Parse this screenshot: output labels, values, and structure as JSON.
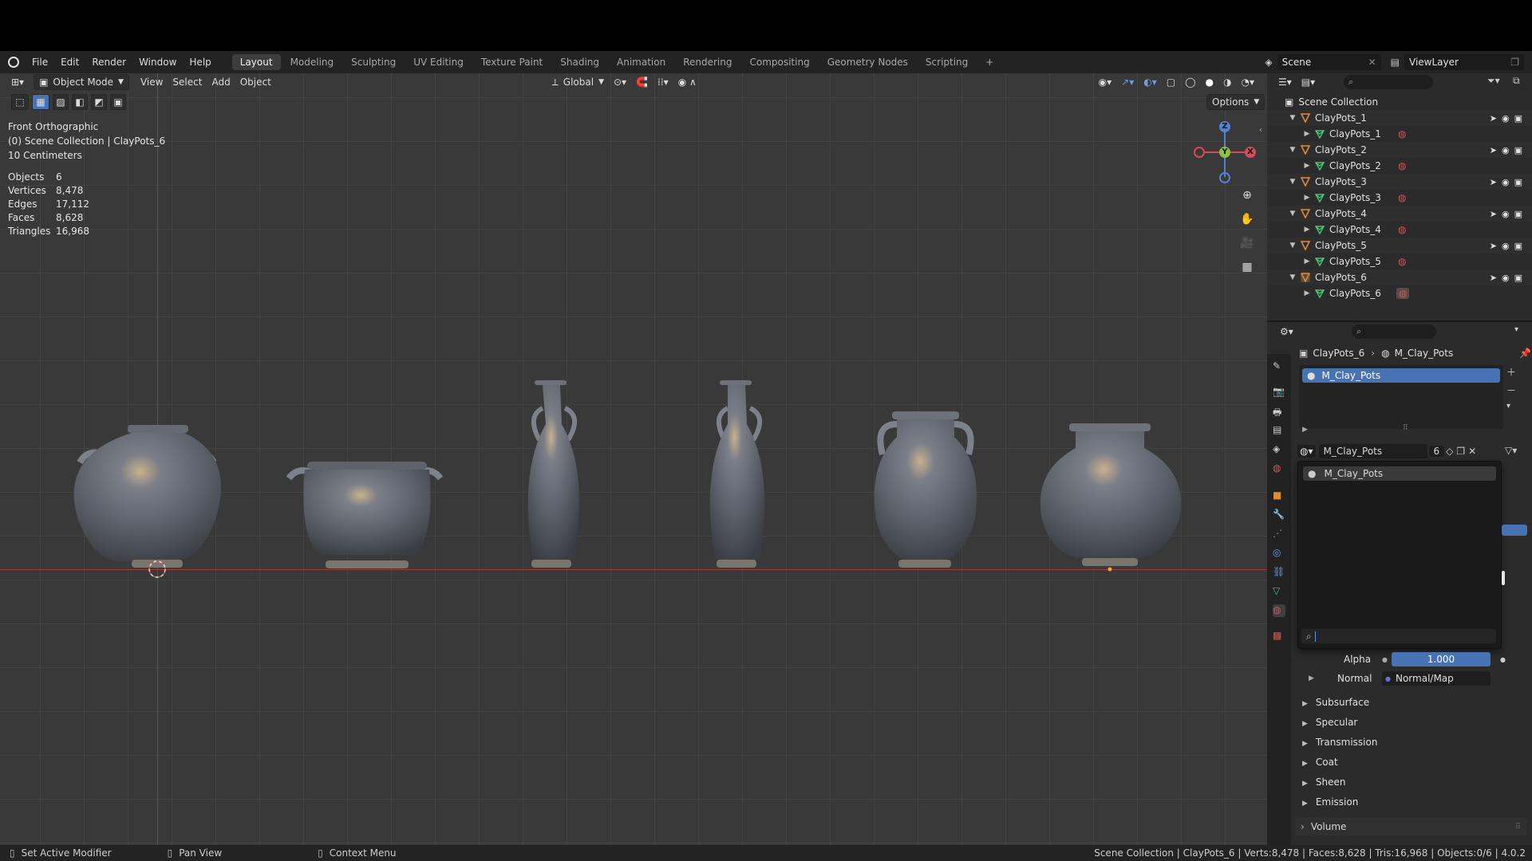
{
  "menubar": {
    "menus": [
      "File",
      "Edit",
      "Render",
      "Window",
      "Help"
    ],
    "workspaces": [
      "Layout",
      "Modeling",
      "Sculpting",
      "UV Editing",
      "Texture Paint",
      "Shading",
      "Animation",
      "Rendering",
      "Compositing",
      "Geometry Nodes",
      "Scripting"
    ],
    "add_workspace": "+",
    "scene": "Scene",
    "view_layer": "ViewLayer"
  },
  "viewport": {
    "mode": "Object Mode",
    "menus": [
      "View",
      "Select",
      "Add",
      "Object"
    ],
    "transform_orientation": "Global",
    "options_label": "Options",
    "view_name": "Front Orthographic",
    "collection_line": "(0) Scene Collection | ClayPots_6",
    "scale_line": "10 Centimeters",
    "stats": [
      {
        "label": "Objects",
        "value": "6"
      },
      {
        "label": "Vertices",
        "value": "8,478"
      },
      {
        "label": "Edges",
        "value": "17,112"
      },
      {
        "label": "Faces",
        "value": "8,628"
      },
      {
        "label": "Triangles",
        "value": "16,968"
      }
    ],
    "gizmo": {
      "x": "X",
      "y": "Y",
      "z": "Z"
    }
  },
  "outliner": {
    "root": "Scene Collection",
    "items": [
      {
        "object": "ClayPots_1",
        "mesh": "ClayPots_1"
      },
      {
        "object": "ClayPots_2",
        "mesh": "ClayPots_2"
      },
      {
        "object": "ClayPots_3",
        "mesh": "ClayPots_3"
      },
      {
        "object": "ClayPots_4",
        "mesh": "ClayPots_4"
      },
      {
        "object": "ClayPots_5",
        "mesh": "ClayPots_5"
      },
      {
        "object": "ClayPots_6",
        "mesh": "ClayPots_6"
      }
    ]
  },
  "properties": {
    "breadcrumb_object": "ClayPots_6",
    "breadcrumb_material": "M_Clay_Pots",
    "slot_name": "M_Clay_Pots",
    "material_name": "M_Clay_Pots",
    "user_count": "6",
    "dropdown_item": "M_Clay_Pots",
    "alpha_label": "Alpha",
    "alpha_value": "1.000",
    "normal_label": "Normal",
    "normal_value": "Normal/Map",
    "subpanels": [
      "Subsurface",
      "Specular",
      "Transmission",
      "Coat",
      "Sheen",
      "Emission"
    ],
    "volume_label": "Volume"
  },
  "statusbar": {
    "left1": "Set Active Modifier",
    "left2": "Pan View",
    "left3": "Context Menu",
    "right": "Scene Collection | ClayPots_6 | Verts:8,478 | Faces:8,628 | Tris:16,968 | Objects:0/6 | 4.0.2"
  },
  "colors": {
    "accent_blue": "#4772b3",
    "object_orange": "#e08a3c",
    "mesh_green": "#4cc277",
    "material_red": "#c45a5a"
  }
}
